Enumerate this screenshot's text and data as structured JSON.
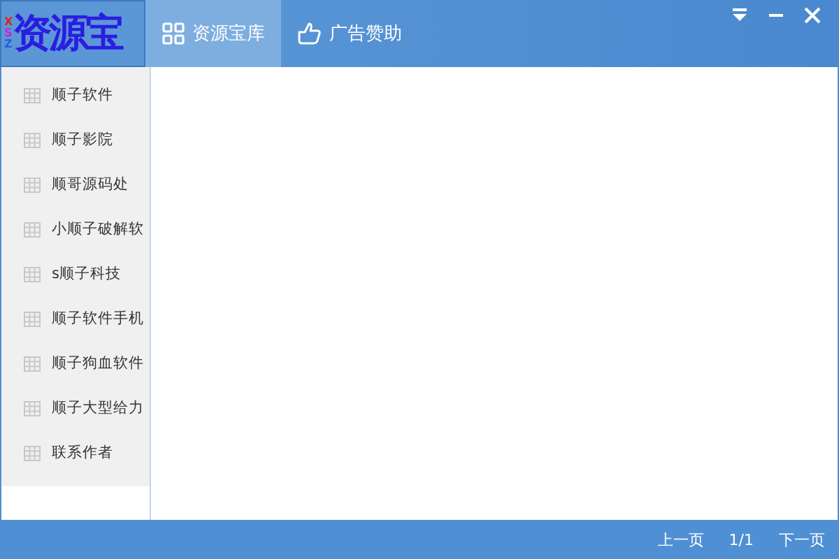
{
  "logo": {
    "prefix": "XSZ",
    "title": "资源宝"
  },
  "tabs": [
    {
      "label": "资源宝库",
      "selected": true
    },
    {
      "label": "广告赞助",
      "selected": false
    }
  ],
  "sidebar": {
    "items": [
      {
        "label": "顺子软件"
      },
      {
        "label": "顺子影院"
      },
      {
        "label": "顺哥源码处"
      },
      {
        "label": "小顺子破解软"
      },
      {
        "label": "s顺子科技"
      },
      {
        "label": "顺子软件手机"
      },
      {
        "label": "顺子狗血软件"
      },
      {
        "label": "顺子大型给力"
      },
      {
        "label": "联系作者"
      }
    ]
  },
  "status_bar": {
    "prev": "上一页",
    "page": "1/1",
    "next": "下一页"
  }
}
